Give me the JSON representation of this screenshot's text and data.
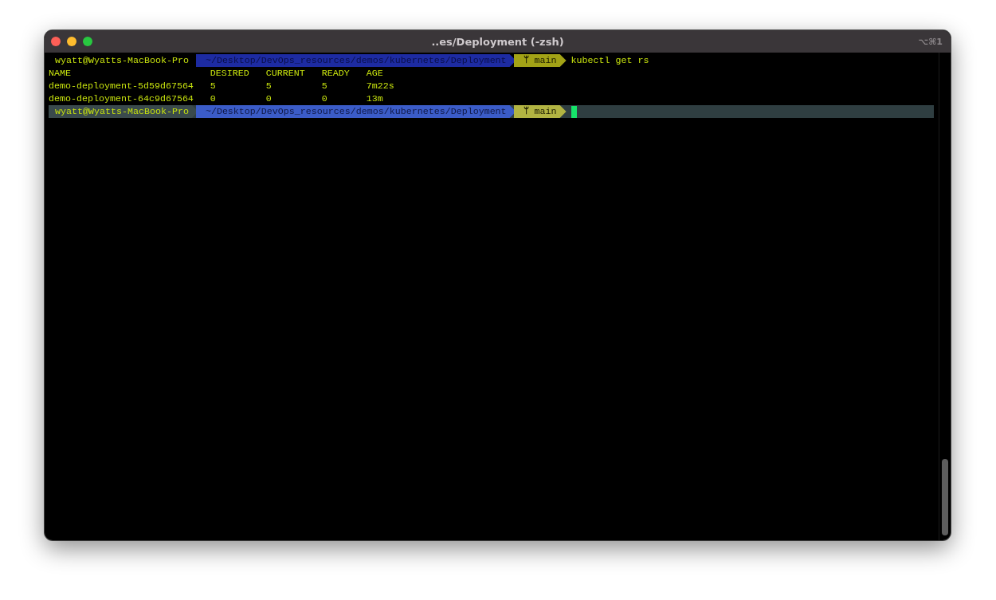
{
  "window": {
    "title": "..es/Deployment (-zsh)",
    "shortcut": "⌥⌘1"
  },
  "lines": [
    {
      "kind": "prompt",
      "user": "wyatt@Wyatts-MacBook-Pro",
      "path": "~/Desktop/DevOps_resources/demos/kubernetes/Deployment",
      "branch_icon": "ᛘ",
      "branch": "main",
      "command": "kubectl get rs",
      "current": false
    },
    {
      "kind": "table",
      "columns": [
        "NAME",
        "DESIRED",
        "CURRENT",
        "READY",
        "AGE"
      ],
      "rows": [
        [
          "demo-deployment-5d59d67564",
          "5",
          "5",
          "5",
          "7m22s"
        ],
        [
          "demo-deployment-64c9d67564",
          "0",
          "0",
          "0",
          "13m"
        ]
      ]
    },
    {
      "kind": "prompt",
      "user": "wyatt@Wyatts-MacBook-Pro",
      "path": "~/Desktop/DevOps_resources/demos/kubernetes/Deployment",
      "branch_icon": "ᛘ",
      "branch": "main",
      "current": true
    }
  ]
}
